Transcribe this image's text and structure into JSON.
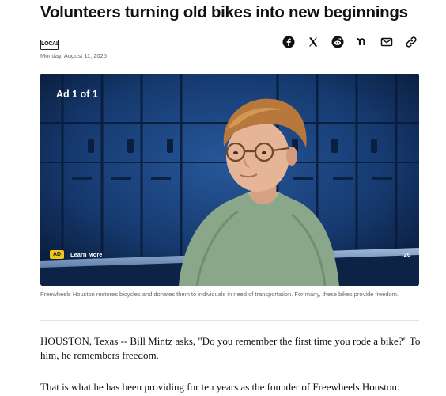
{
  "article": {
    "headline": "Volunteers turning old bikes into new beginnings",
    "source_logo": "LOCAL",
    "date": "Monday, August 11, 2025"
  },
  "share": {
    "icons": [
      "facebook-icon",
      "x-icon",
      "reddit-icon",
      "nextdoor-icon",
      "email-icon",
      "link-icon"
    ]
  },
  "video": {
    "ad_counter": "Ad 1 of 1",
    "ad_badge": "AD",
    "learn_more": "Learn More",
    "duration": ":20"
  },
  "caption": "Freewheels Houston restores bicycles and donates them to individuals in need of transportation. For many, these bikes provide freedom.",
  "body": {
    "p1": "HOUSTON, Texas -- Bill Mintz asks, \"Do you remember the first time you rode a bike?\" To him, he remembers freedom.",
    "p2": "That is what he has been providing for ten years as the founder of Freewheels Houston."
  },
  "colors": {
    "ad_badge": "#f0c419",
    "video_background": "#0b1e3c"
  }
}
